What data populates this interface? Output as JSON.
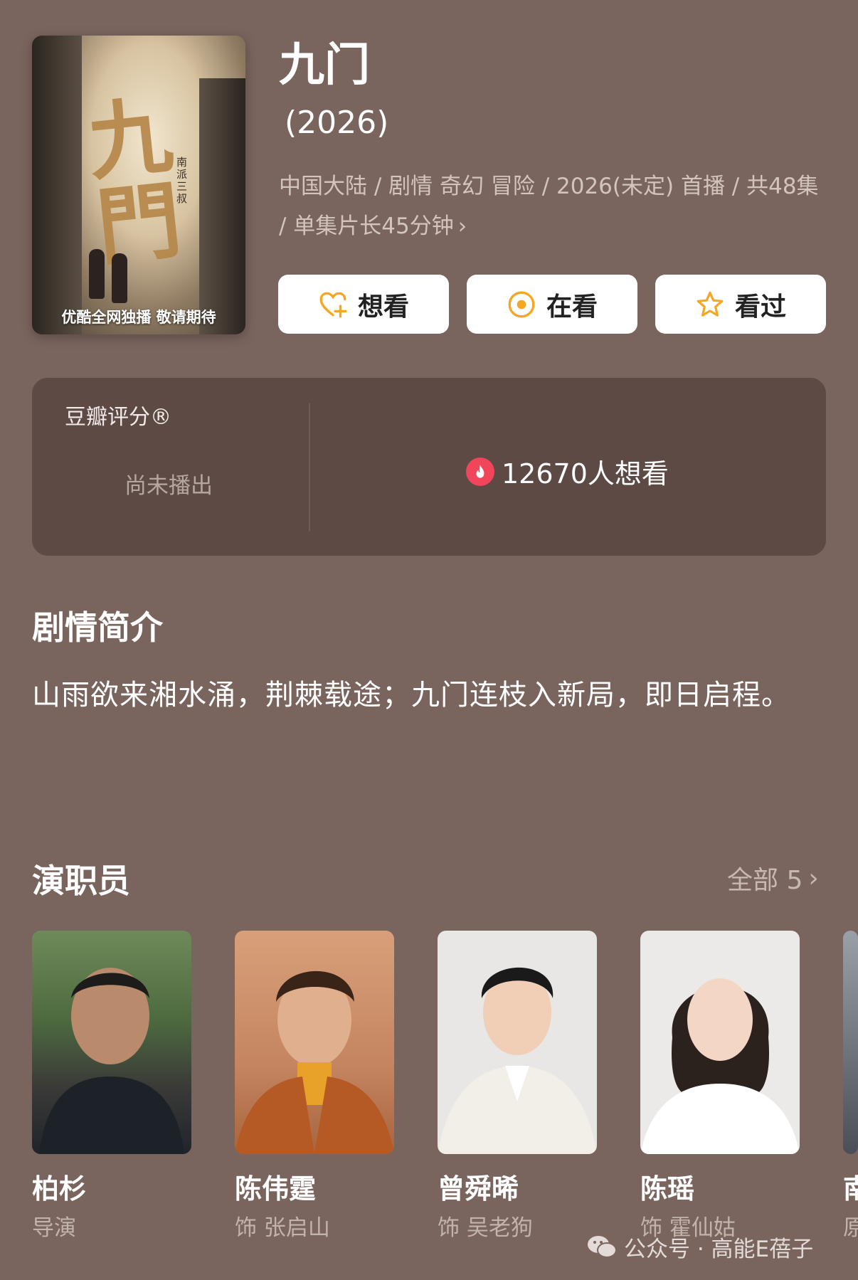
{
  "poster": {
    "caption": "优酷全网独播 敬请期待",
    "calligraphy": "九門",
    "side_text": "南派三叔"
  },
  "title": "九门",
  "year": "(2026)",
  "meta": {
    "line": "中国大陆 / 剧情 奇幻 冒险 / 2026(未定) 首播 / 共48集 / 单集片长45分钟"
  },
  "actions": [
    {
      "label": "想看",
      "icon": "heart-plus-icon"
    },
    {
      "label": "在看",
      "icon": "target-icon"
    },
    {
      "label": "看过",
      "icon": "star-icon"
    }
  ],
  "rating": {
    "label": "豆瓣评分®",
    "status": "尚未播出",
    "want_count": "12670人想看"
  },
  "synopsis": {
    "title": "剧情简介",
    "text": "山雨欲来湘水涌，荆棘载途；九门连枝入新局，即日启程。"
  },
  "cast": {
    "title": "演职员",
    "all_label": "全部 5",
    "members": [
      {
        "name": "柏杉",
        "role": "导演"
      },
      {
        "name": "陈伟霆",
        "role": "饰 张启山"
      },
      {
        "name": "曾舜晞",
        "role": "饰 吴老狗"
      },
      {
        "name": "陈瑶",
        "role": "饰 霍仙姑"
      },
      {
        "name": "南",
        "role": "原"
      }
    ]
  },
  "watermark": "公众号 · 高能E蓓子",
  "colors": {
    "background": "#7a645e",
    "card": "#5d4a45",
    "accent": "#f5a623"
  }
}
